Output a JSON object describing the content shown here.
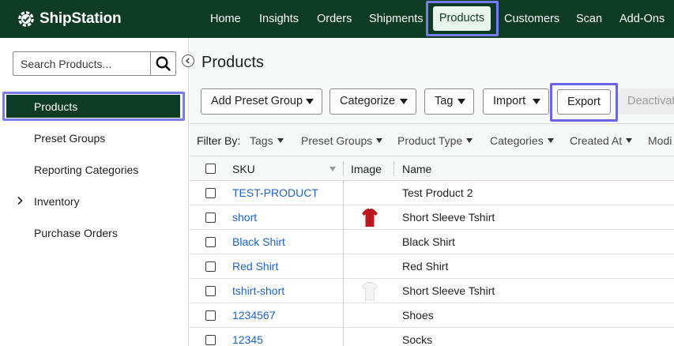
{
  "app": {
    "brand": "ShipStation"
  },
  "nav": {
    "items": [
      "Home",
      "Insights",
      "Orders",
      "Shipments",
      "Products",
      "Customers",
      "Scan",
      "Add-Ons"
    ],
    "active": "Products"
  },
  "sidebar": {
    "search_placeholder": "Search Products...",
    "items": [
      "Products",
      "Preset Groups",
      "Reporting Categories",
      "Inventory",
      "Purchase Orders"
    ],
    "active": "Products"
  },
  "main": {
    "title": "Products",
    "toolbar": {
      "add_preset_group": "Add Preset Group",
      "categorize": "Categorize",
      "tag": "Tag",
      "import": "Import",
      "export": "Export",
      "deactivate": "Deactivat"
    },
    "filter": {
      "label": "Filter By:",
      "items": [
        "Tags",
        "Preset Groups",
        "Product Type",
        "Categories",
        "Created At",
        "Modi"
      ]
    },
    "table": {
      "columns": [
        "SKU",
        "Image",
        "Name"
      ],
      "rows": [
        {
          "sku": "TEST-PRODUCT",
          "name": "Test Product 2",
          "image": ""
        },
        {
          "sku": "short",
          "name": "Short Sleeve Tshirt",
          "image": "red-tshirt"
        },
        {
          "sku": "Black Shirt",
          "name": "Black Shirt",
          "image": ""
        },
        {
          "sku": "Red Shirt",
          "name": "Red Shirt",
          "image": ""
        },
        {
          "sku": "tshirt-short",
          "name": "Short Sleeve Tshirt",
          "image": "white-tshirt"
        },
        {
          "sku": "1234567",
          "name": "Shoes",
          "image": ""
        },
        {
          "sku": "12345",
          "name": "Socks",
          "image": ""
        }
      ]
    }
  },
  "colors": {
    "nav_bg": "#0d3b23",
    "highlight": "#7b7bf0",
    "link": "#1d62c7",
    "shirt_red": "#c0161d"
  }
}
